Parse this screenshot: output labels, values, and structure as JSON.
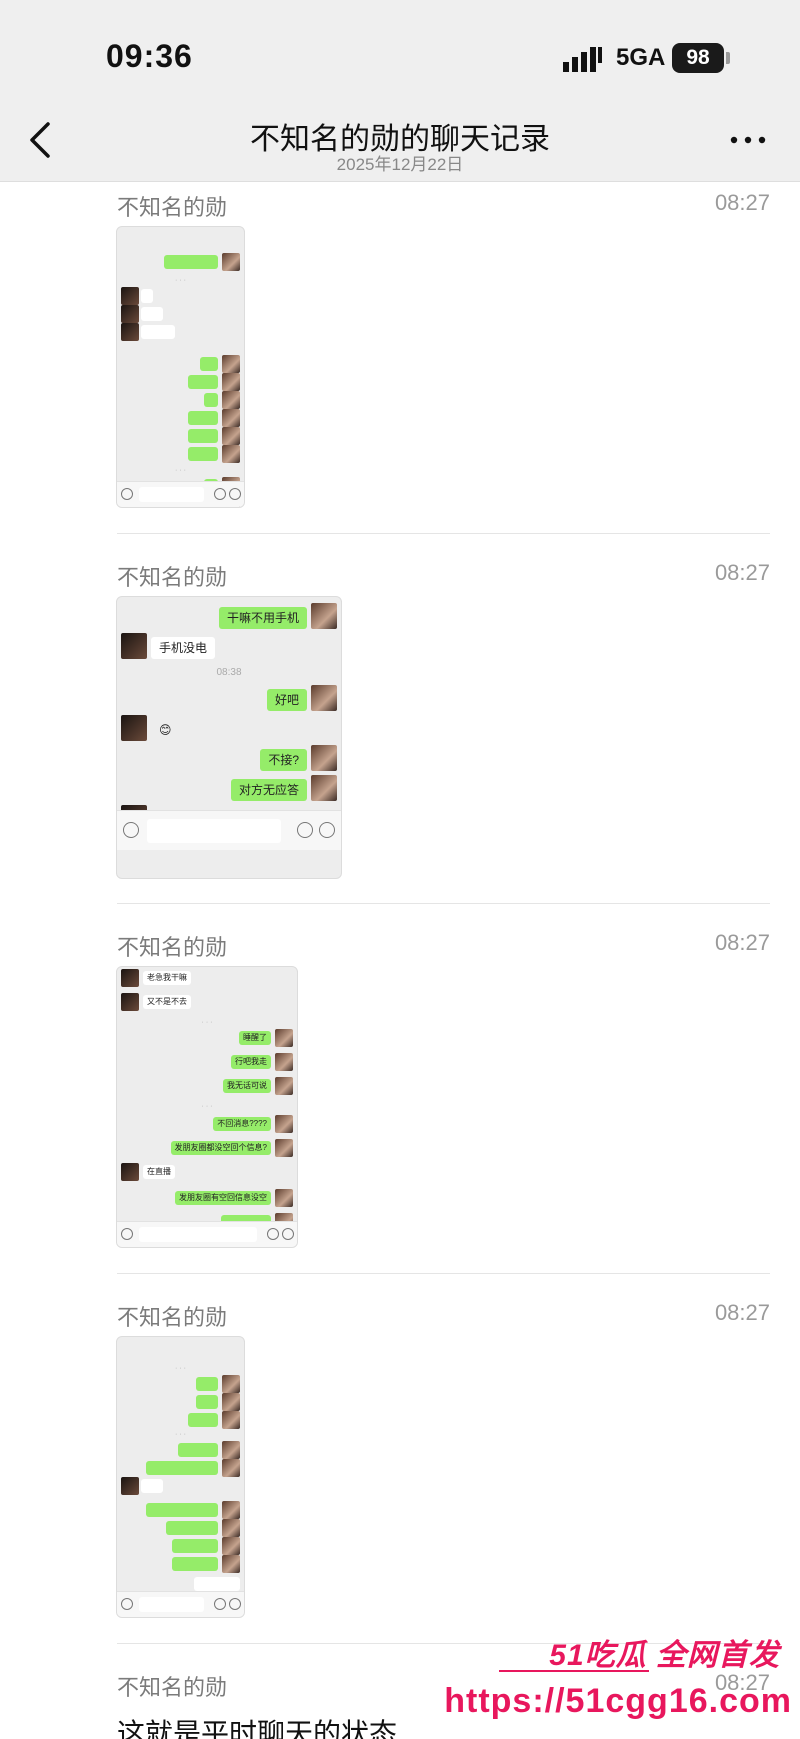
{
  "status": {
    "time": "09:36",
    "network": "5GA",
    "battery": "98"
  },
  "nav": {
    "title": "不知名的勋的聊天记录",
    "subtitle": "2025年12月22日"
  },
  "messages": [
    {
      "sender": "不知名的勋",
      "time": "08:27",
      "type": "image"
    },
    {
      "sender": "不知名的勋",
      "time": "08:27",
      "type": "image"
    },
    {
      "sender": "不知名的勋",
      "time": "08:27",
      "type": "image"
    },
    {
      "sender": "不知名的勋",
      "time": "08:27",
      "type": "image"
    },
    {
      "sender": "不知名的勋",
      "time": "08:27",
      "type": "text",
      "text": "这就是平时聊天的状态"
    }
  ],
  "screenshot2": {
    "bubbles": [
      "干嘛不用手机",
      "手机没电",
      "好吧",
      "不接?",
      "对方无应答",
      "?"
    ],
    "divider": "08:38"
  },
  "screenshot3": {
    "bubbles": [
      "老急我干嘛",
      "又不是不去",
      "睡醒了",
      "行吧我走",
      "我无话可说",
      "不回消息????",
      "发朋友圈都没空回个信息?",
      "在直播",
      "发朋友圈有空回信息没空"
    ]
  },
  "watermark": {
    "brand": "51吃瓜 全网首发",
    "url": "https://51cgg16.com"
  }
}
